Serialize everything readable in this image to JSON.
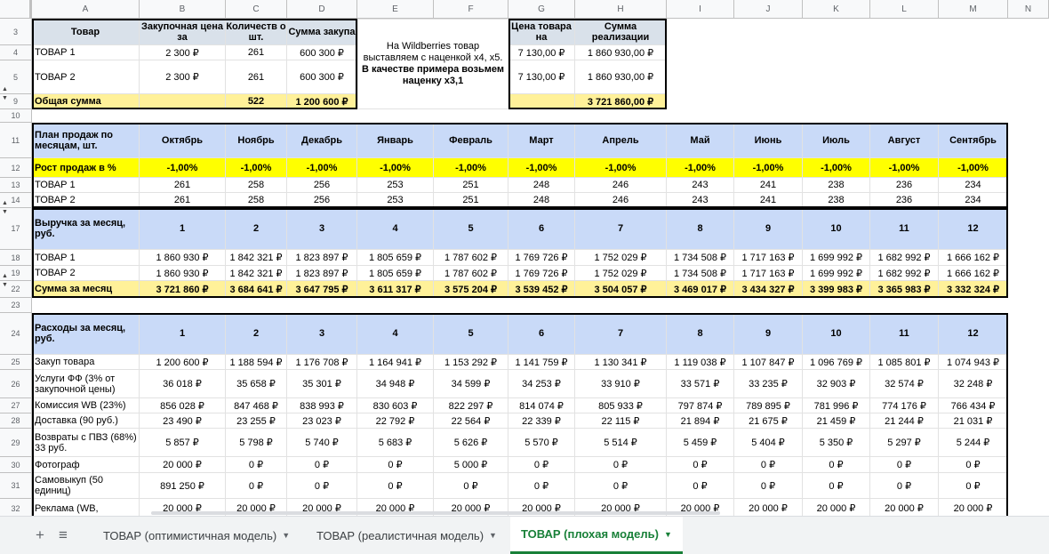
{
  "columns": [
    "A",
    "B",
    "C",
    "D",
    "E",
    "F",
    "G",
    "H",
    "I",
    "J",
    "K",
    "L",
    "M",
    "N"
  ],
  "top_table": {
    "row_nums": [
      "3",
      "4",
      "5",
      "9",
      "10"
    ],
    "headers": [
      "Товар",
      "Закупочная цена за",
      "Количеств о шт.",
      "Сумма закупа",
      "Цена товара на",
      "Сумма реализации"
    ],
    "rows": [
      {
        "name": "ТОВАР 1",
        "price": "2 300 ₽",
        "qty": "261",
        "sum": "600 300 ₽",
        "wb_price": "7 130,00 ₽",
        "real": "1 860 930,00 ₽"
      },
      {
        "name": "ТОВАР 2",
        "price": "2 300 ₽",
        "qty": "261",
        "sum": "600 300 ₽",
        "wb_price": "7 130,00 ₽",
        "real": "1 860 930,00 ₽"
      }
    ],
    "total": {
      "label": "Общая сумма",
      "qty": "522",
      "sum": "1 200 600 ₽",
      "real": "3 721 860,00 ₽"
    },
    "note_line1": "На Wildberries товар выставляем с наценкой х4, х5.",
    "note_line2": "В качестве примера возьмем наценку х3,1"
  },
  "plan": {
    "row_nums": [
      "11",
      "12",
      "13",
      "14"
    ],
    "title": "План продаж по месяцам, шт.",
    "months": [
      "Октябрь",
      "Ноябрь",
      "Декабрь",
      "Январь",
      "Февраль",
      "Март",
      "Апрель",
      "Май",
      "Июнь",
      "Июль",
      "Август",
      "Сентябрь"
    ],
    "growth_label": "Рост продаж в %",
    "growth": [
      "-1,00%",
      "-1,00%",
      "-1,00%",
      "-1,00%",
      "-1,00%",
      "-1,00%",
      "-1,00%",
      "-1,00%",
      "-1,00%",
      "-1,00%",
      "-1,00%",
      "-1,00%"
    ],
    "rows": [
      {
        "name": "ТОВАР 1",
        "values": [
          "261",
          "258",
          "256",
          "253",
          "251",
          "248",
          "246",
          "243",
          "241",
          "238",
          "236",
          "234"
        ]
      },
      {
        "name": "ТОВАР 2",
        "values": [
          "261",
          "258",
          "256",
          "253",
          "251",
          "248",
          "246",
          "243",
          "241",
          "238",
          "236",
          "234"
        ]
      }
    ]
  },
  "revenue": {
    "row_nums": [
      "17",
      "18",
      "19",
      "22",
      "23"
    ],
    "title": "Выручка за месяц, руб.",
    "nums": [
      "1",
      "2",
      "3",
      "4",
      "5",
      "6",
      "7",
      "8",
      "9",
      "10",
      "11",
      "12"
    ],
    "rows": [
      {
        "name": "ТОВАР 1",
        "values": [
          "1 860 930 ₽",
          "1 842 321 ₽",
          "1 823 897 ₽",
          "1 805 659 ₽",
          "1 787 602 ₽",
          "1 769 726 ₽",
          "1 752 029 ₽",
          "1 734 508 ₽",
          "1 717 163 ₽",
          "1 699 992 ₽",
          "1 682 992 ₽",
          "1 666 162 ₽"
        ]
      },
      {
        "name": "ТОВАР 2",
        "values": [
          "1 860 930 ₽",
          "1 842 321 ₽",
          "1 823 897 ₽",
          "1 805 659 ₽",
          "1 787 602 ₽",
          "1 769 726 ₽",
          "1 752 029 ₽",
          "1 734 508 ₽",
          "1 717 163 ₽",
          "1 699 992 ₽",
          "1 682 992 ₽",
          "1 666 162 ₽"
        ]
      }
    ],
    "total_label": "Сумма за месяц",
    "totals": [
      "3 721 860 ₽",
      "3 684 641 ₽",
      "3 647 795 ₽",
      "3 611 317 ₽",
      "3 575 204 ₽",
      "3 539 452 ₽",
      "3 504 057 ₽",
      "3 469 017 ₽",
      "3 434 327 ₽",
      "3 399 983 ₽",
      "3 365 983 ₽",
      "3 332 324 ₽"
    ]
  },
  "expenses": {
    "row_nums": [
      "24",
      "25",
      "26",
      "27",
      "28",
      "29",
      "30",
      "31",
      "32"
    ],
    "title": "Расходы за месяц, руб.",
    "nums": [
      "1",
      "2",
      "3",
      "4",
      "5",
      "6",
      "7",
      "8",
      "9",
      "10",
      "11",
      "12"
    ],
    "rows": [
      {
        "name": "Закуп товара",
        "values": [
          "1 200 600 ₽",
          "1 188 594 ₽",
          "1 176 708 ₽",
          "1 164 941 ₽",
          "1 153 292 ₽",
          "1 141 759 ₽",
          "1 130 341 ₽",
          "1 119 038 ₽",
          "1 107 847 ₽",
          "1 096 769 ₽",
          "1 085 801 ₽",
          "1 074 943 ₽"
        ]
      },
      {
        "name": "Услуги ФФ (3% от закупочной цены)",
        "values": [
          "36 018 ₽",
          "35 658 ₽",
          "35 301 ₽",
          "34 948 ₽",
          "34 599 ₽",
          "34 253 ₽",
          "33 910 ₽",
          "33 571 ₽",
          "33 235 ₽",
          "32 903 ₽",
          "32 574 ₽",
          "32 248 ₽"
        ]
      },
      {
        "name": "Комиссия WB (23%)",
        "values": [
          "856 028 ₽",
          "847 468 ₽",
          "838 993 ₽",
          "830 603 ₽",
          "822 297 ₽",
          "814 074 ₽",
          "805 933 ₽",
          "797 874 ₽",
          "789 895 ₽",
          "781 996 ₽",
          "774 176 ₽",
          "766 434 ₽"
        ]
      },
      {
        "name": "Доставка (90 руб.)",
        "values": [
          "23 490 ₽",
          "23 255 ₽",
          "23 023 ₽",
          "22 792 ₽",
          "22 564 ₽",
          "22 339 ₽",
          "22 115 ₽",
          "21 894 ₽",
          "21 675 ₽",
          "21 459 ₽",
          "21 244 ₽",
          "21 031 ₽"
        ]
      },
      {
        "name": "Возвраты с ПВЗ (68%) 33 руб.",
        "values": [
          "5 857 ₽",
          "5 798 ₽",
          "5 740 ₽",
          "5 683 ₽",
          "5 626 ₽",
          "5 570 ₽",
          "5 514 ₽",
          "5 459 ₽",
          "5 404 ₽",
          "5 350 ₽",
          "5 297 ₽",
          "5 244 ₽"
        ]
      },
      {
        "name": "Фотограф",
        "values": [
          "20 000 ₽",
          "0 ₽",
          "0 ₽",
          "0 ₽",
          "5 000 ₽",
          "0 ₽",
          "0 ₽",
          "0 ₽",
          "0 ₽",
          "0 ₽",
          "0 ₽",
          "0 ₽"
        ]
      },
      {
        "name": "Самовыкуп (50 единиц)",
        "values": [
          "891 250 ₽",
          "0 ₽",
          "0 ₽",
          "0 ₽",
          "0 ₽",
          "0 ₽",
          "0 ₽",
          "0 ₽",
          "0 ₽",
          "0 ₽",
          "0 ₽",
          "0 ₽"
        ]
      },
      {
        "name": "Реклама (WB,",
        "values": [
          "20 000 ₽",
          "20 000 ₽",
          "20 000 ₽",
          "20 000 ₽",
          "20 000 ₽",
          "20 000 ₽",
          "20 000 ₽",
          "20 000 ₽",
          "20 000 ₽",
          "20 000 ₽",
          "20 000 ₽",
          "20 000 ₽"
        ]
      }
    ]
  },
  "tabs": [
    {
      "label": "ТОВАР (оптимистичная модель)",
      "active": false
    },
    {
      "label": "ТОВАР (реалистичная модель)",
      "active": false
    },
    {
      "label": "ТОВАР (плохая модель)",
      "active": true
    }
  ],
  "icons": {
    "add": "add-sheet-icon",
    "all_sheets": "all-sheets-icon"
  },
  "colors": {
    "yellow": "#fff199",
    "bright_yellow": "#ffff00",
    "blue": "#c9daf8",
    "active_tab": "#188038"
  }
}
